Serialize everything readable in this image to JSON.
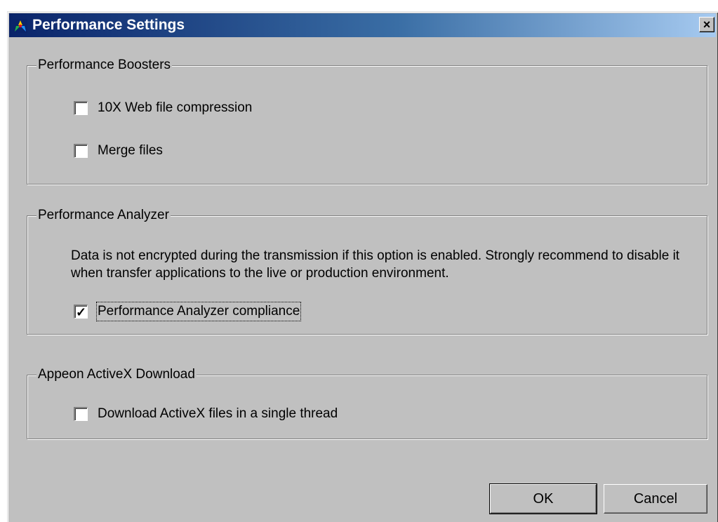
{
  "window": {
    "title": "Performance Settings",
    "close_glyph": "×",
    "titlebar_colors": [
      "#0a246a",
      "#a6caf0"
    ]
  },
  "boosters": {
    "legend": "Performance Boosters",
    "items": [
      {
        "label": "10X Web file compression",
        "checked": false
      },
      {
        "label": "Merge files",
        "checked": false
      }
    ]
  },
  "analyzer": {
    "legend": "Performance Analyzer",
    "note": "Data is not encrypted during the transmission if this option is enabled. Strongly recommend to disable it when transfer applications to the live or production environment.",
    "compliance": {
      "label": "Performance Analyzer compliance",
      "checked": true,
      "check_glyph": "✓"
    }
  },
  "activex": {
    "legend": "Appeon ActiveX Download",
    "single_thread": {
      "label": "Download ActiveX files in a single thread",
      "checked": false
    }
  },
  "buttons": {
    "ok": "OK",
    "cancel": "Cancel"
  }
}
